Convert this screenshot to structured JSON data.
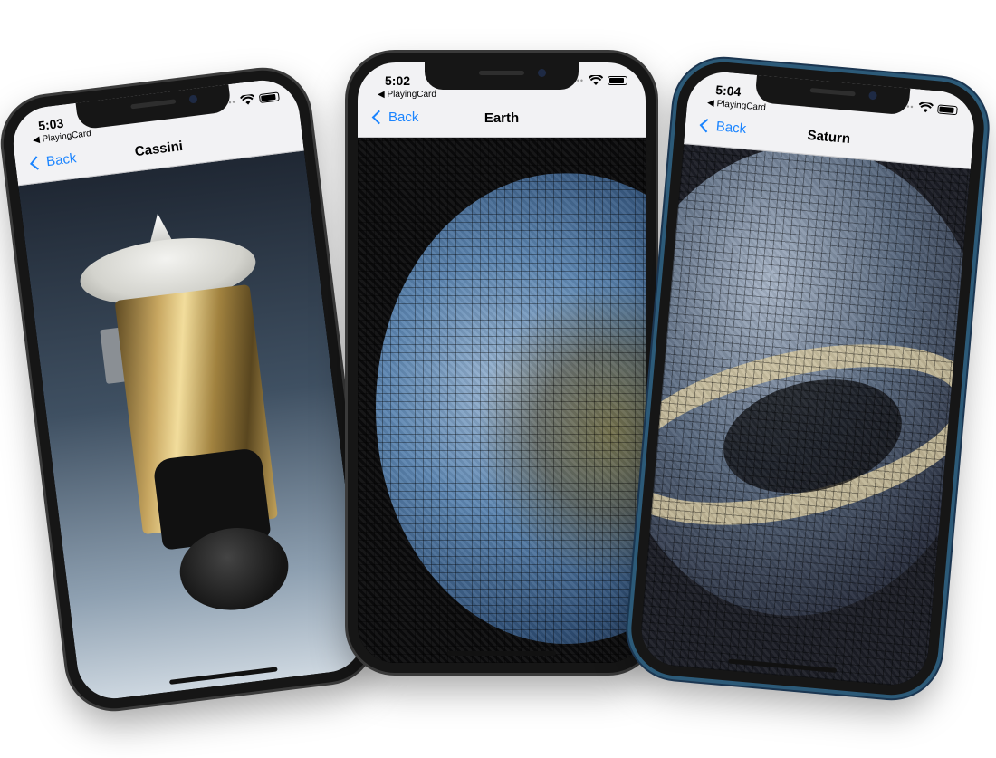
{
  "phones": [
    {
      "time": "5:03",
      "return_app": "◀ PlayingCard",
      "back_label": "Back",
      "title": "Cassini",
      "image": "cassini-spacecraft-photo"
    },
    {
      "time": "5:02",
      "return_app": "◀ PlayingCard",
      "back_label": "Back",
      "title": "Earth",
      "image": "earth-photo-mosaic"
    },
    {
      "time": "5:04",
      "return_app": "◀ PlayingCard",
      "back_label": "Back",
      "title": "Saturn",
      "image": "saturn-photo-mosaic"
    }
  ],
  "status_icons": [
    "signal-dots-icon",
    "wifi-icon",
    "battery-icon"
  ],
  "colors": {
    "accent": "#1a84ff",
    "navbar": "#f2f2f4",
    "frame": "#161616",
    "blue_frame": "#2c5a78"
  }
}
